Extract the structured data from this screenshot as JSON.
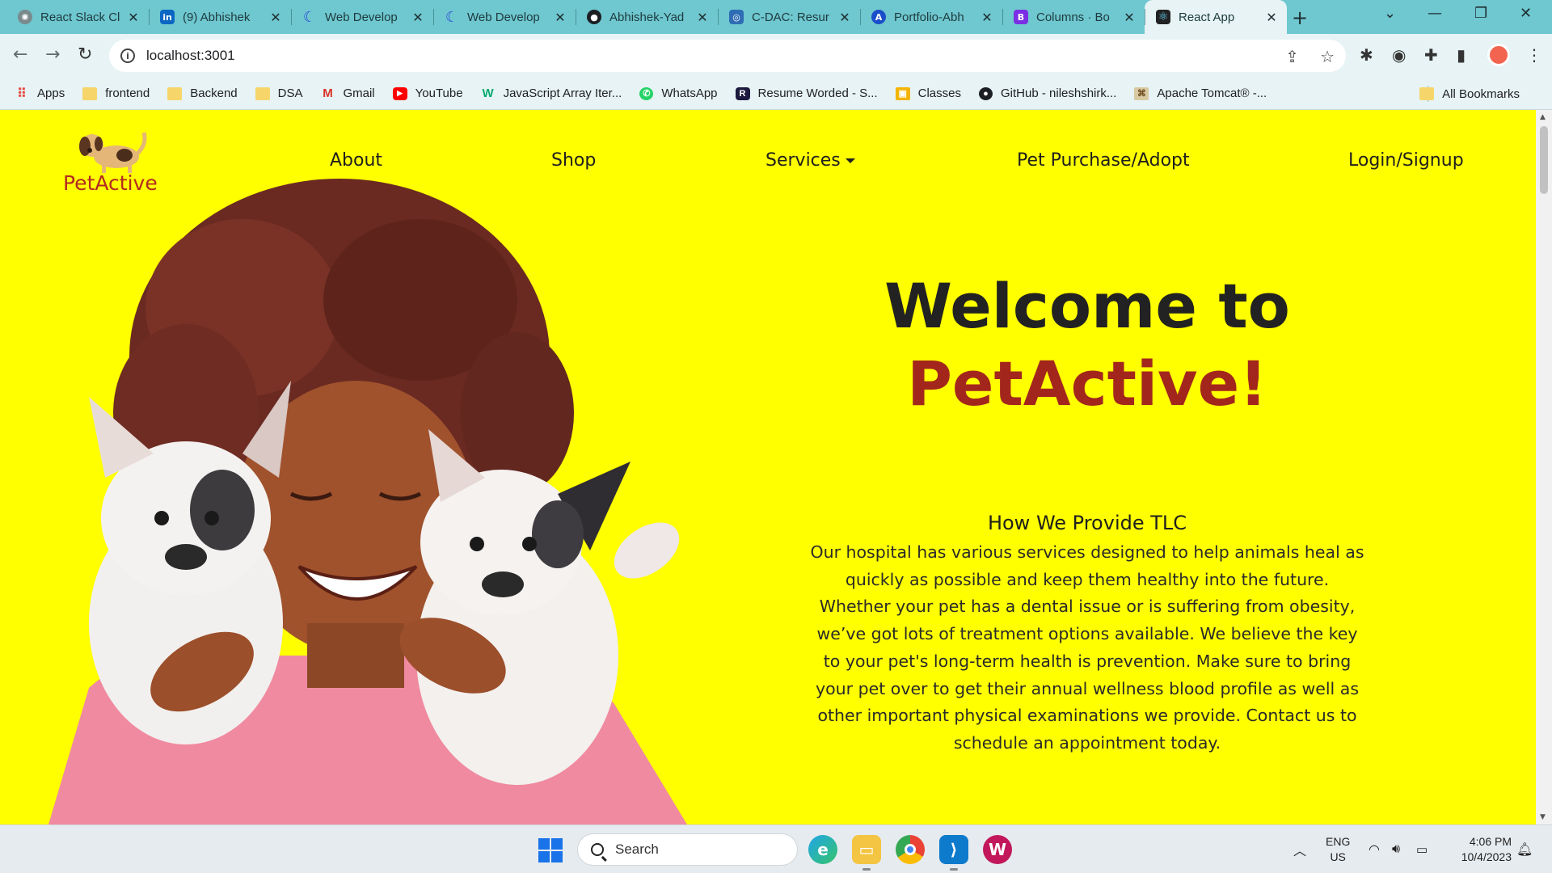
{
  "browser": {
    "tabs": [
      {
        "label": "React Slack Cl",
        "icon": "openai-icon",
        "color": "#5f6b6d"
      },
      {
        "label": "(9) Abhishek",
        "icon": "linkedin-icon",
        "color": "#0a66c2"
      },
      {
        "label": "Web Develop",
        "icon": "udemy-icon",
        "color": "#2a4bd7"
      },
      {
        "label": "Web Develop",
        "icon": "udemy-icon",
        "color": "#2a4bd7"
      },
      {
        "label": "Abhishek-Yad",
        "icon": "github-icon",
        "color": "#1b1f23"
      },
      {
        "label": "C-DAC: Resur",
        "icon": "cdac-icon",
        "color": "#2e6db4"
      },
      {
        "label": "Portfolio-Abh",
        "icon": "portfolio-icon",
        "color": "#1a4fc9"
      },
      {
        "label": "Columns · Bo",
        "icon": "bootstrap-icon",
        "color": "#7b2fe4"
      },
      {
        "label": "React App",
        "icon": "react-icon",
        "color": "#222222"
      }
    ],
    "active_tab_index": 8,
    "url": "localhost:3001",
    "bookmarks": [
      {
        "label": "Apps",
        "icon": "apps-grid-icon"
      },
      {
        "label": "frontend",
        "icon": "folder-icon"
      },
      {
        "label": "Backend",
        "icon": "folder-icon"
      },
      {
        "label": "DSA",
        "icon": "folder-icon"
      },
      {
        "label": "Gmail",
        "icon": "gmail-icon"
      },
      {
        "label": "YouTube",
        "icon": "youtube-icon"
      },
      {
        "label": "JavaScript Array Iter...",
        "icon": "w3schools-icon"
      },
      {
        "label": "WhatsApp",
        "icon": "whatsapp-icon"
      },
      {
        "label": "Resume Worded - S...",
        "icon": "resume-worded-icon"
      },
      {
        "label": "Classes",
        "icon": "classroom-icon"
      },
      {
        "label": "GitHub - nileshshirk...",
        "icon": "github-icon"
      },
      {
        "label": "Apache Tomcat® -...",
        "icon": "tomcat-icon"
      }
    ],
    "all_bookmarks": "All Bookmarks"
  },
  "page": {
    "logo_text": "PetActive",
    "nav": {
      "about": "About",
      "shop": "Shop",
      "services": "Services",
      "pet_purchase": "Pet Purchase/Adopt",
      "login": "Login/Signup"
    },
    "welcome_line1": "Welcome to",
    "welcome_line2": "PetActive!",
    "tlc_heading": "How We Provide TLC",
    "tlc_text": "Our hospital has various services designed to help animals heal as quickly as possible and keep them healthy into the future. Whether your pet has a dental issue or is suffering from obesity, we’ve got lots of treatment options available. We believe the key to your pet's long-term health is prevention. Make sure to bring your pet over to get their annual wellness blood profile as well as other important physical examinations we provide. Contact us to schedule an appointment today.",
    "colors": {
      "background": "#ffff00",
      "accent": "#a3261d",
      "heading": "#222222"
    }
  },
  "taskbar": {
    "search_placeholder": "Search",
    "apps": [
      "edge-icon",
      "file-explorer-icon",
      "chrome-icon",
      "vscode-icon",
      "winzip-icon"
    ],
    "lang_line1": "ENG",
    "lang_line2": "US",
    "time": "4:06 PM",
    "date": "10/4/2023"
  }
}
